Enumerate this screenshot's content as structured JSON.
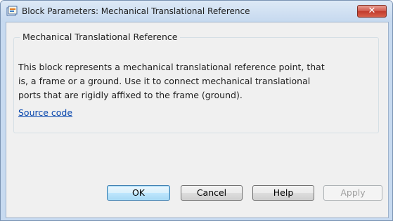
{
  "window": {
    "title": "Block Parameters: Mechanical Translational Reference",
    "close_label": "✕"
  },
  "group": {
    "title": "Mechanical Translational Reference",
    "description_lines": [
      "This block represents a mechanical translational reference point, that",
      "is, a frame or a ground. Use it to connect mechanical translational",
      "ports that are rigidly affixed to the frame (ground)."
    ],
    "link_label": "Source code"
  },
  "buttons": {
    "ok_label": "OK",
    "cancel_label": "Cancel",
    "help_label": "Help",
    "apply_label": "Apply"
  },
  "icons": {
    "app": "simulink-block-icon",
    "close": "close-icon"
  },
  "colors": {
    "link": "#0645ad",
    "close_button": "#c94a3b",
    "default_button_border": "#3c7fb1"
  }
}
